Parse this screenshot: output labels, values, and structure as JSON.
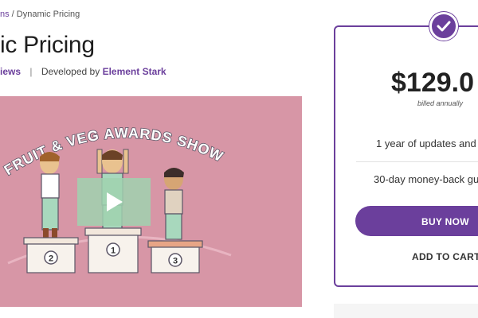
{
  "breadcrumb": {
    "parent_fragment": "ns",
    "separator": " / ",
    "current": "Dynamic Pricing"
  },
  "page_title": "ic Pricing",
  "meta": {
    "reviews_fragment": "iews",
    "separator": "|",
    "developed_by_label": "Developed by",
    "developer": "Element Stark"
  },
  "video": {
    "banner_text": "FRUIT & VEG AWARDS SHOW",
    "podium_labels": [
      "2",
      "1",
      "3"
    ],
    "play_icon": "play-icon"
  },
  "pricing": {
    "price": "$129.0",
    "billing_note": "billed annually",
    "features": [
      "1 year of updates and s",
      "30-day money-back gua"
    ],
    "buy_label": "BUY NOW",
    "cart_label": "ADD TO CART",
    "badge_icon": "check-icon"
  },
  "colors": {
    "brand_purple": "#6b3f9c",
    "video_background": "#d796a6"
  }
}
